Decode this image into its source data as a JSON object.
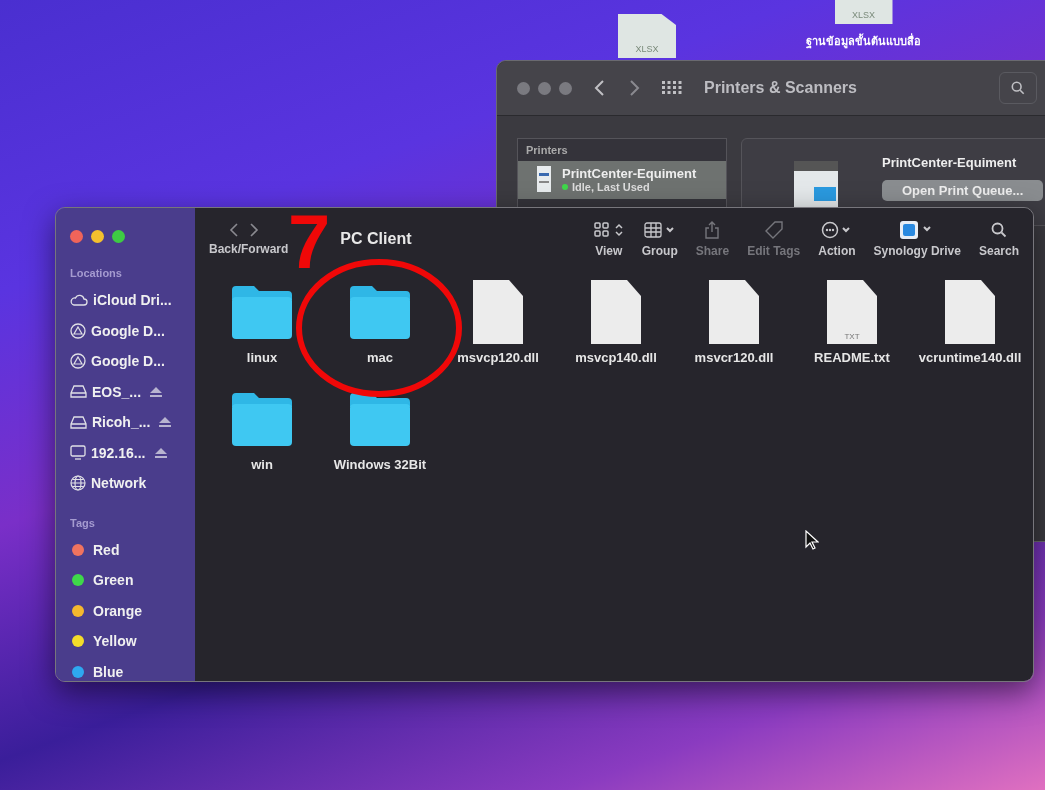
{
  "desktop_icons": [
    {
      "file_type": "XLSX"
    },
    {
      "file_type": "XLSX",
      "label": "ฐานข้อมูลขั้นต้นแบบสื่อ"
    }
  ],
  "printers_window": {
    "title": "Printers & Scanners",
    "list_header": "Printers",
    "printers": [
      {
        "name": "PrintCenter-Equiment",
        "status": "Idle, Last Used",
        "selected": true
      }
    ],
    "detail": {
      "name": "PrintCenter-Equiment",
      "button": "Open Print Queue..."
    }
  },
  "finder": {
    "title": "PC Client",
    "nav_label": "Back/Forward",
    "tools": [
      {
        "kind": "view",
        "label": "View",
        "disabled": false
      },
      {
        "kind": "group",
        "label": "Group",
        "disabled": false
      },
      {
        "kind": "share",
        "label": "Share",
        "disabled": true
      },
      {
        "kind": "tags",
        "label": "Edit Tags",
        "disabled": true
      },
      {
        "kind": "action",
        "label": "Action",
        "disabled": false
      },
      {
        "kind": "drive",
        "label": "Synology Drive",
        "disabled": false
      },
      {
        "kind": "search",
        "label": "Search",
        "disabled": false
      }
    ],
    "sidebar": {
      "locations_header": "Locations",
      "locations": [
        {
          "kind": "cloud",
          "label": "iCloud Dri...",
          "eject": false
        },
        {
          "kind": "drive",
          "label": "Google D...",
          "eject": false
        },
        {
          "kind": "drive",
          "label": "Google D...",
          "eject": false
        },
        {
          "kind": "disk",
          "label": "EOS_...",
          "eject": true
        },
        {
          "kind": "disk",
          "label": "Ricoh_...",
          "eject": true
        },
        {
          "kind": "monitor",
          "label": "192.16...",
          "eject": true
        },
        {
          "kind": "globe",
          "label": "Network",
          "eject": false
        }
      ],
      "tags_header": "Tags",
      "tags": [
        {
          "label": "Red",
          "color": "#f0735f"
        },
        {
          "label": "Green",
          "color": "#3fd84a"
        },
        {
          "label": "Orange",
          "color": "#f5b82e"
        },
        {
          "label": "Yellow",
          "color": "#f4dc2a"
        },
        {
          "label": "Blue",
          "color": "#2ea8f0"
        }
      ]
    },
    "files": [
      {
        "kind": "folder",
        "name": "linux"
      },
      {
        "kind": "folder",
        "name": "mac"
      },
      {
        "kind": "document",
        "name": "msvcp120.dll"
      },
      {
        "kind": "document",
        "name": "msvcp140.dll"
      },
      {
        "kind": "document",
        "name": "msvcr120.dll"
      },
      {
        "kind": "text",
        "name": "README.txt",
        "badge": "TXT"
      },
      {
        "kind": "document",
        "name": "vcruntime140.dll"
      },
      {
        "kind": "folder",
        "name": "win"
      },
      {
        "kind": "folder",
        "name": "Windows 32Bit"
      }
    ]
  },
  "annotation": {
    "number": "7"
  }
}
